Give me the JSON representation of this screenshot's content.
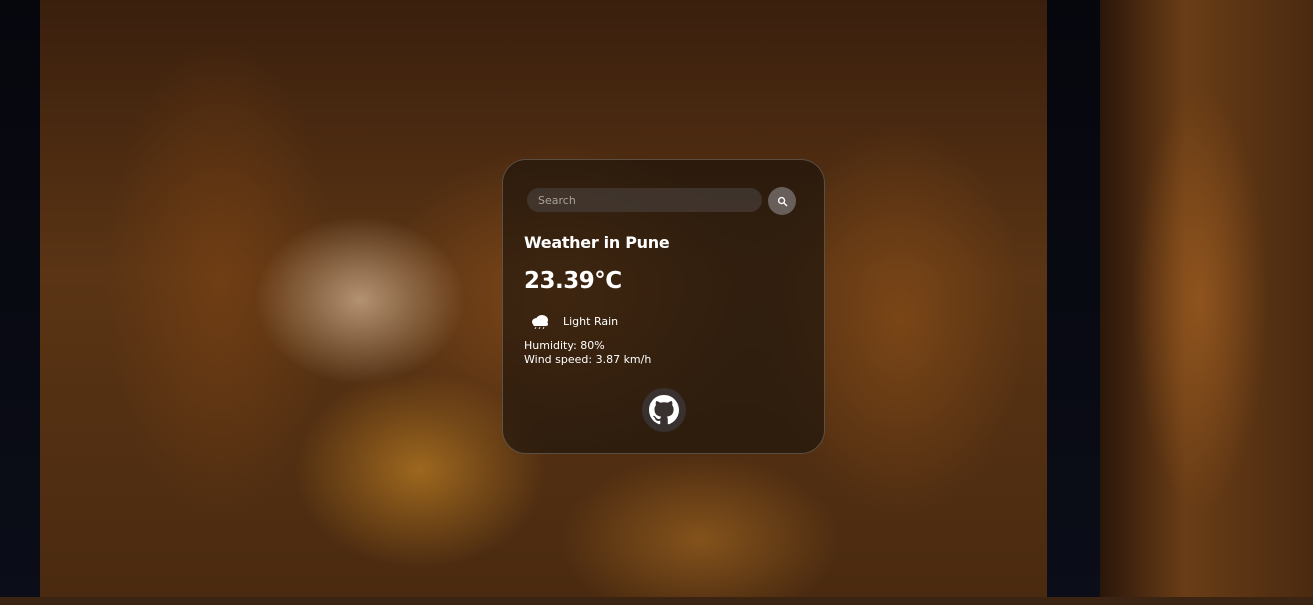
{
  "search": {
    "placeholder": "Search",
    "value": "",
    "button_icon": "search-icon"
  },
  "weather": {
    "title": "Weather in Pune",
    "temperature": "23.39°C",
    "condition_icon": "cloud-rain-icon",
    "condition": "Light Rain",
    "humidity": "Humidity: 80%",
    "wind": "Wind speed: 3.87 km/h"
  },
  "footer": {
    "github_icon": "github-icon"
  },
  "colors": {
    "card_background": "#19120c",
    "text": "#ffffff",
    "search_field": "#463c37",
    "search_button": "#736c68"
  }
}
